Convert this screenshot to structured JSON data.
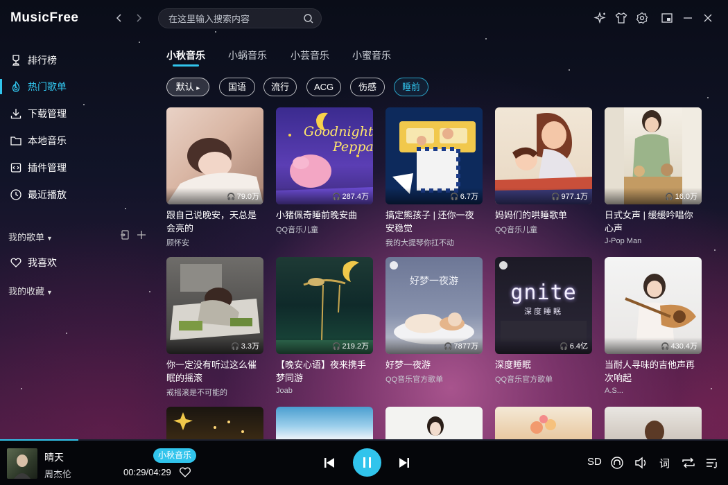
{
  "app": {
    "title": "MusicFree"
  },
  "search": {
    "placeholder": "在这里输入搜索内容"
  },
  "sidebar": {
    "items": [
      {
        "label": "排行榜",
        "icon": "trophy-icon"
      },
      {
        "label": "热门歌单",
        "icon": "fire-icon",
        "active": true
      },
      {
        "label": "下载管理",
        "icon": "download-icon"
      },
      {
        "label": "本地音乐",
        "icon": "folder-icon"
      },
      {
        "label": "插件管理",
        "icon": "plugin-icon"
      },
      {
        "label": "最近播放",
        "icon": "clock-icon"
      }
    ],
    "my_playlists_label": "我的歌单",
    "favorites_label": "我喜欢",
    "my_collection_label": "我的收藏"
  },
  "tabs": [
    "小秋音乐",
    "小蜗音乐",
    "小芸音乐",
    "小蜜音乐"
  ],
  "filters": {
    "default_label": "默认",
    "chips": [
      "国语",
      "流行",
      "ACG",
      "伤感",
      "睡前"
    ],
    "selected": "睡前"
  },
  "playlists": [
    {
      "title": "跟自己说晚安，天总是会亮的",
      "author": "顾怀安",
      "plays": "79.0万"
    },
    {
      "title": "小猪佩奇睡前晚安曲",
      "author": "QQ音乐儿童",
      "plays": "287.4万",
      "cover_text_1": "Goodnight",
      "cover_text_2": "Peppa"
    },
    {
      "title": "搞定熊孩子 | 还你一夜安稳觉",
      "author": "我的大提琴你扛不动",
      "plays": "6.7万"
    },
    {
      "title": "妈妈们的哄睡歌单",
      "author": "QQ音乐儿童",
      "plays": "977.1万"
    },
    {
      "title": "日式女声 | 缓缓吟唱你心声",
      "author": "J-Pop Man",
      "plays": "16.0万"
    },
    {
      "title": "你一定没有听过这么催眠的摇滚",
      "author": "戒摇滚是不可能的",
      "plays": "3.3万"
    },
    {
      "title": "【晚安心语】夜来携手梦同游",
      "author": "Joab",
      "plays": "219.2万"
    },
    {
      "title": "好梦一夜游",
      "author": "QQ音乐官方歌单",
      "plays": "7877万",
      "cover_text_1": "好梦一夜游"
    },
    {
      "title": "深度睡眠",
      "author": "QQ音乐官方歌单",
      "plays": "6.4亿",
      "cover_text_1": "gnite",
      "cover_text_2": "深度睡眠"
    },
    {
      "title": "当耐人寻味的吉他声再次响起",
      "author": "A.S...",
      "plays": "430.4万"
    }
  ],
  "player": {
    "song": "晴天",
    "artist": "周杰伦",
    "source": "小秋音乐",
    "time": "00:29/04:29",
    "quality": "SD",
    "lyric_label": "词",
    "progress": 0.108
  },
  "colors": {
    "accent": "#31c4ec"
  }
}
